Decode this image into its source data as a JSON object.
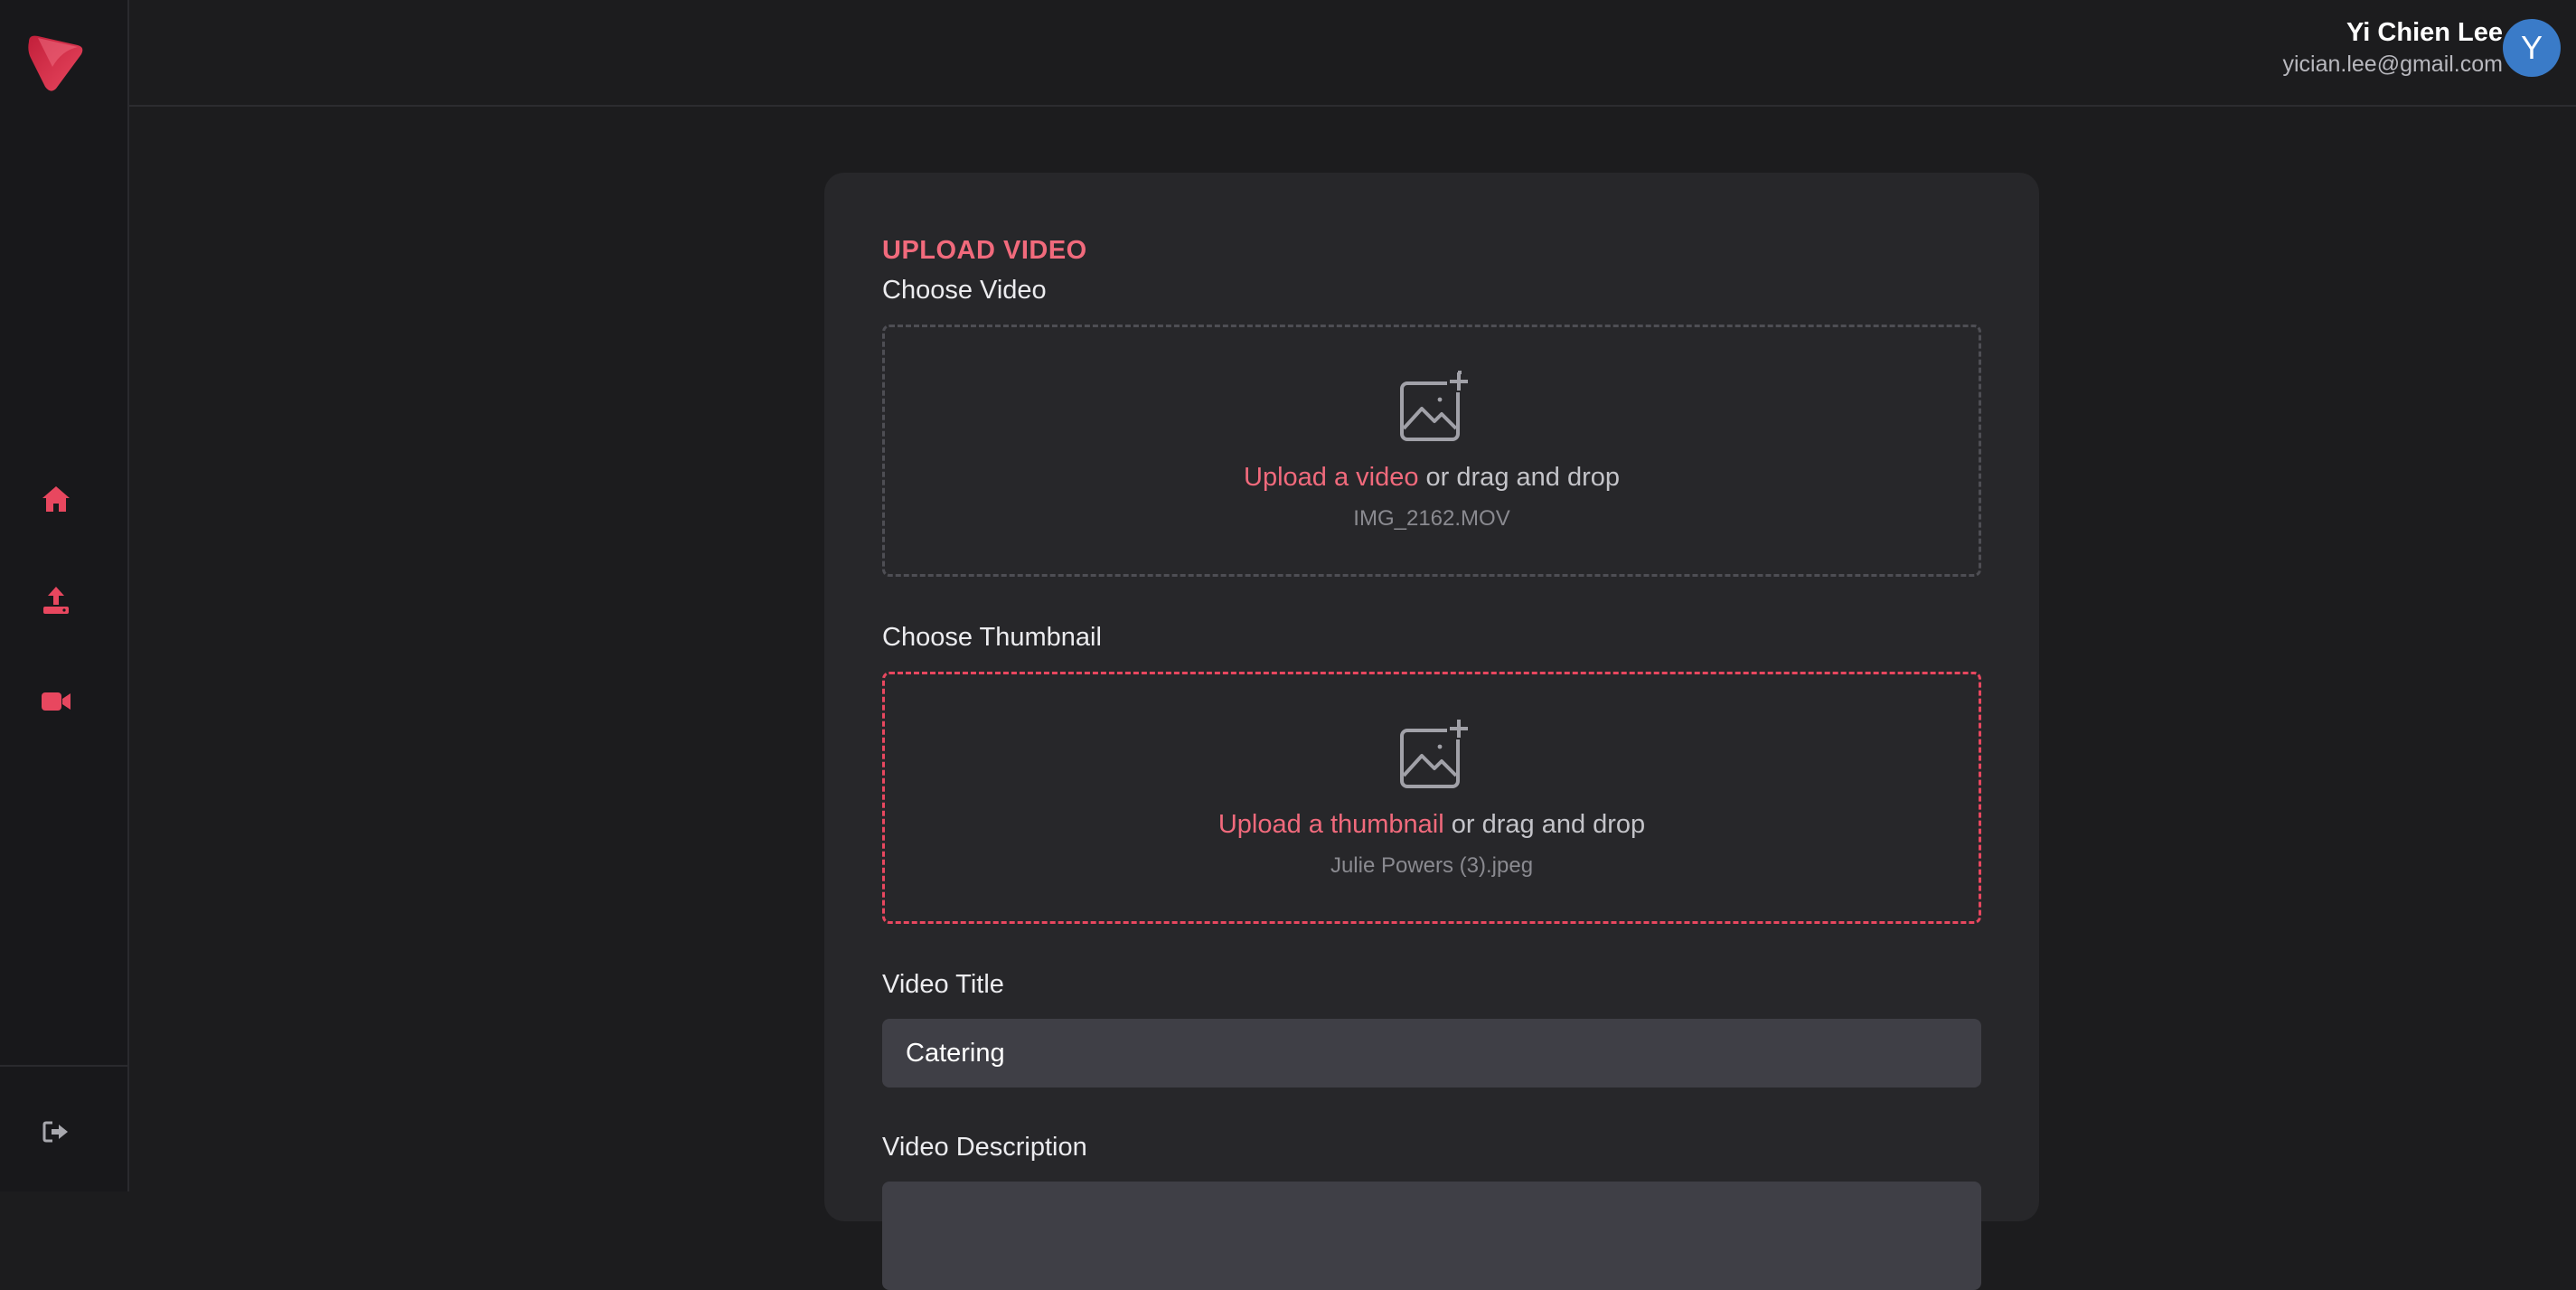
{
  "user": {
    "name": "Yi Chien Lee",
    "email": "yician.lee@gmail.com",
    "avatar_initial": "Y"
  },
  "sidebar": {
    "items": [
      {
        "icon": "home-icon"
      },
      {
        "icon": "upload-icon"
      },
      {
        "icon": "video-camera-icon"
      }
    ],
    "logout_icon": "logout-icon"
  },
  "form": {
    "title": "UPLOAD VIDEO",
    "video": {
      "label": "Choose Video",
      "link_text": "Upload a video",
      "rest_text": " or drag and drop",
      "file_name": "IMG_2162.MOV"
    },
    "thumbnail": {
      "label": "Choose Thumbnail",
      "link_text": "Upload a thumbnail",
      "rest_text": " or drag and drop",
      "file_name": "Julie Powers (3).jpeg"
    },
    "video_title": {
      "label": "Video Title",
      "value": "Catering"
    },
    "video_description": {
      "label": "Video Description",
      "value": ""
    }
  },
  "colors": {
    "accent": "#f16a7c",
    "brand": "#e8475f",
    "avatar_bg": "#3a7bc8"
  }
}
